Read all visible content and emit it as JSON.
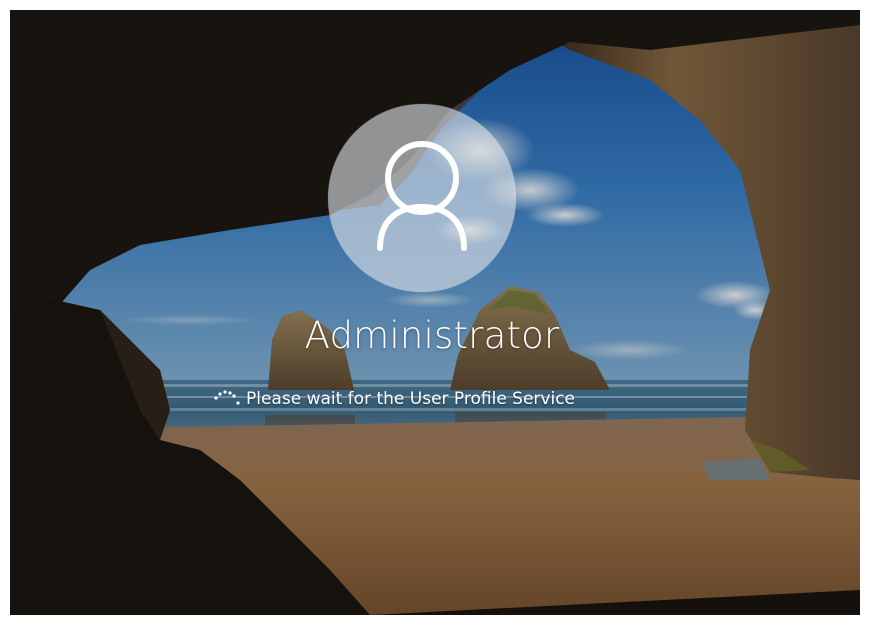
{
  "lock_screen": {
    "background": "sea-cave-beach-wallpaper",
    "colors": {
      "sky": "#2f78c2",
      "sea": "#3c6a8c",
      "sand": "#a07a55",
      "cave": "#171310",
      "text": "#ffffff"
    }
  },
  "login": {
    "avatar_icon": "user-icon",
    "username": "Administrator",
    "status_icon": "loading-spinner-icon",
    "status_text": "Please wait for the User Profile Service"
  }
}
